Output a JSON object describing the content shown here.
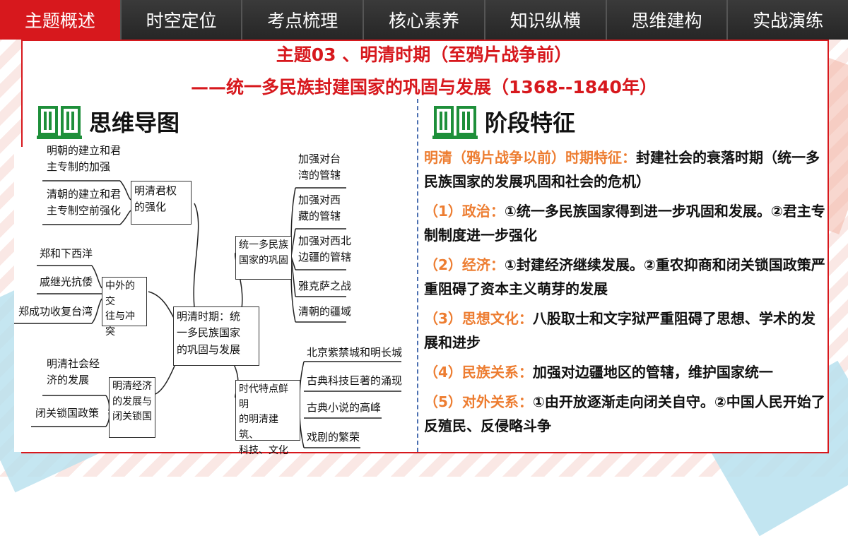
{
  "nav": {
    "tabs": [
      {
        "label": "主题概述",
        "active": true
      },
      {
        "label": "时空定位",
        "active": false
      },
      {
        "label": "考点梳理",
        "active": false
      },
      {
        "label": "核心素养",
        "active": false
      },
      {
        "label": "知识纵横",
        "active": false
      },
      {
        "label": "思维建构",
        "active": false
      },
      {
        "label": "实战演练",
        "active": false
      }
    ],
    "active_color": "#d7181d"
  },
  "title": {
    "line1": "主题03 、明清时期（至鸦片战争前）",
    "line2": "——统一多民族封建国家的巩固与发展（1368--1840年）"
  },
  "left_section": {
    "heading": "思维导图",
    "icon": "book-icon",
    "mindmap": {
      "center": "明清时期：统\n一多民族国家\n的巩固与发展",
      "branches": {
        "autocracy": {
          "label": "明清君权\n的强化",
          "items": [
            "明朝的建立和君\n主专制的加强",
            "清朝的建立和君\n主专制空前强化"
          ]
        },
        "foreign": {
          "label": "中外的交\n往与冲突",
          "items": [
            "郑和下西洋",
            "戚继光抗倭",
            "郑成功收复台湾"
          ]
        },
        "economy": {
          "label": "明清经济\n的发展与\n闭关锁国",
          "items": [
            "明清社会经\n济的发展",
            "闭关锁国政策"
          ]
        },
        "unity": {
          "label": "统一多民族\n国家的巩固",
          "items": [
            "加强对台\n湾的管辖",
            "加强对西\n藏的管辖",
            "加强对西北\n边疆的管辖",
            "雅克萨之战",
            "清朝的疆域"
          ]
        },
        "culture": {
          "label": "时代特点鲜明\n的明清建筑、\n科技、文化",
          "items": [
            "北京紫禁城和明长城",
            "古典科技巨著的涌现",
            "古典小说的高峰",
            "戏剧的繁荣"
          ]
        }
      }
    }
  },
  "right_section": {
    "heading": "阶段特征",
    "icon": "book-icon",
    "intro_label": "明清（鸦片战争以前）时期特征：",
    "intro_text": "封建社会的衰落时期（统一多民族国家的发展巩固和社会的危机）",
    "points": [
      {
        "label": "（1）政治：",
        "text": "①统一多民族国家得到进一步巩固和发展。②君主专制制度进一步强化"
      },
      {
        "label": "（2）经济：",
        "text": "①封建经济继续发展。②重农抑商和闭关锁国政策严重阻碍了资本主义萌芽的发展"
      },
      {
        "label": "（3）思想文化：",
        "text": "八股取士和文字狱严重阻碍了思想、学术的发展和进步"
      },
      {
        "label": "（4）民族关系：",
        "text": "加强对边疆地区的管辖，维护国家统一"
      },
      {
        "label": "（5）对外关系：",
        "text": "①由开放逐渐走向闭关自守。②中国人民开始了反殖民、反侵略斗争"
      }
    ],
    "label_color": "#ed7d31"
  }
}
